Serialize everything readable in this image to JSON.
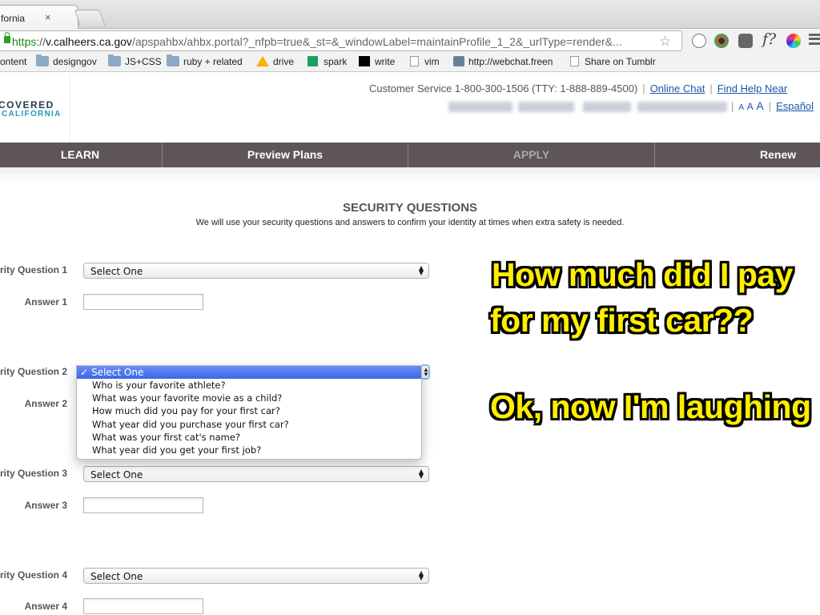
{
  "browser": {
    "tab_title": "fornia",
    "tab_close": "×",
    "url_scheme": "https",
    "url_sep": "://",
    "url_domain": "v.calheers.ca.gov",
    "url_path": "/apspahbx/ahbx.portal?_nfpb=true&_st=&_windowLabel=maintainProfile_1_2&_urlType=render&...",
    "bookmarks": [
      "ontent",
      "designgov",
      "JS+CSS",
      "ruby + related",
      "drive",
      "spark",
      "write",
      "vim",
      "http://webchat.freen",
      "Share on Tumblr"
    ]
  },
  "header": {
    "logo_line1": "COVERED",
    "logo_line2": "CALIFORNIA",
    "customer_service": "Customer Service 1-800-300-1506 (TTY: 1-888-889-4500)",
    "online_chat": "Online Chat",
    "find_help": "Find Help Near",
    "font_sizes": "A A A",
    "espanol": "Español"
  },
  "nav": {
    "learn": "LEARN",
    "preview": "Preview Plans",
    "apply": "APPLY",
    "renew": "Renew"
  },
  "security": {
    "title": "SECURITY QUESTIONS",
    "description": "We will use your security questions and answers to confirm your identity at times when extra safety is needed.",
    "questions": [
      {
        "label": "rity Question 1",
        "selected": "Select One",
        "answer_label": "Answer 1"
      },
      {
        "label": "rity Question 2",
        "selected": "Select One",
        "answer_label": "Answer 2"
      },
      {
        "label": "rity Question 3",
        "selected": "Select One",
        "answer_label": "Answer 3"
      },
      {
        "label": "rity Question 4",
        "selected": "Select One",
        "answer_label": "Answer 4"
      }
    ],
    "dropdown": {
      "check": "✓",
      "selected": "Select One",
      "options": [
        "Who is your favorite athlete?",
        "What was your favorite movie as a child?",
        "How much did you pay for your first car?",
        "What year did you purchase your first car?",
        "What was your first cat's name?",
        "What year did you get your first job?"
      ]
    }
  },
  "overlay": {
    "line1": "How much did I pay",
    "line2": "for my first car??",
    "line3": "Ok, now I'm laughing"
  },
  "colors": {
    "nav_bg": "#5d5557",
    "link": "#1a55a8",
    "meme_text": "#ffee00",
    "highlight": "#3a66e8"
  }
}
